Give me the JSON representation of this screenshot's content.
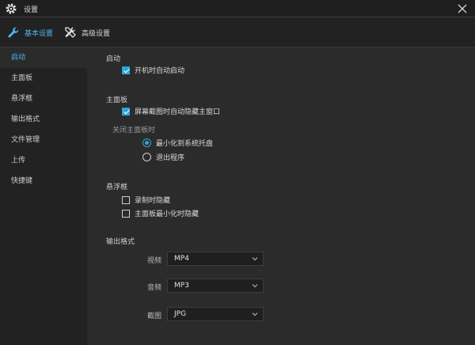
{
  "window": {
    "title": "设置"
  },
  "tabs": [
    {
      "label": "基本设置",
      "icon": "wrench-icon",
      "active": true
    },
    {
      "label": "高级设置",
      "icon": "tools-icon",
      "active": false
    }
  ],
  "sidebar": {
    "items": [
      {
        "label": "启动",
        "active": true
      },
      {
        "label": "主面板"
      },
      {
        "label": "悬浮框"
      },
      {
        "label": "输出格式"
      },
      {
        "label": "文件管理"
      },
      {
        "label": "上传"
      },
      {
        "label": "快捷键"
      }
    ]
  },
  "sections": {
    "startup": {
      "title": "启动",
      "auto_start": {
        "label": "开机时自动启动",
        "checked": true
      }
    },
    "main_panel": {
      "title": "主面板",
      "hide_on_capture": {
        "label": "屏幕截图时自动隐藏主窗口",
        "checked": true
      },
      "close_title": "关闭主面板时",
      "options": [
        {
          "label": "最小化到系统托盘",
          "selected": true
        },
        {
          "label": "退出程序",
          "selected": false
        }
      ]
    },
    "float": {
      "title": "悬浮框",
      "hide_recording": {
        "label": "录制时隐藏",
        "checked": false
      },
      "hide_minimized": {
        "label": "主面板最小化时隐藏",
        "checked": false
      }
    },
    "output": {
      "title": "输出格式",
      "video": {
        "label": "视频",
        "value": "MP4"
      },
      "audio": {
        "label": "音频",
        "value": "MP3"
      },
      "screenshot": {
        "label": "截图",
        "value": "JPG"
      }
    }
  },
  "colors": {
    "accent": "#4ab6f2",
    "check": "#2fa7d9",
    "bg": "#2b2b2b",
    "sidebar": "#222222"
  }
}
